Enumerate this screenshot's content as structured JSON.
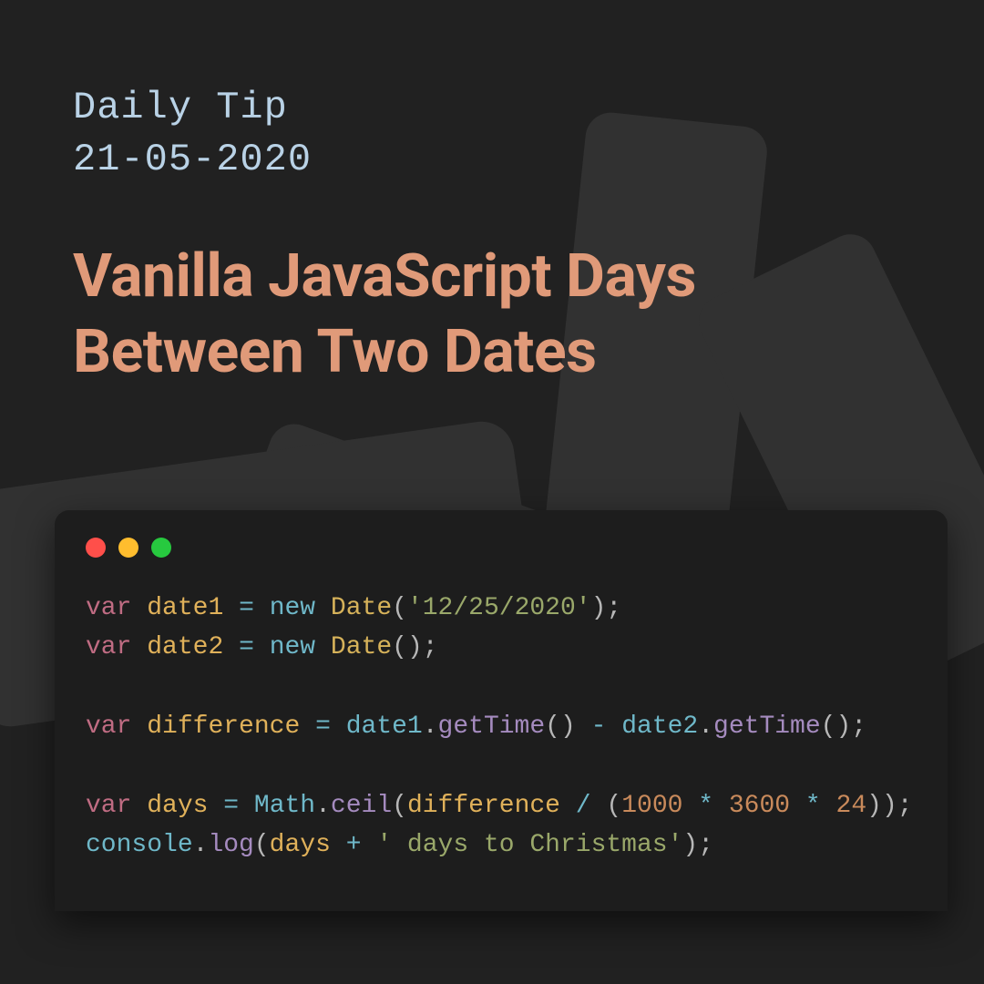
{
  "header": {
    "eyebrow_label": "Daily Tip",
    "date": "21-05-2020",
    "title": "Vanilla JavaScript Days Between Two Dates"
  },
  "code": {
    "tokens": [
      [
        [
          "kw",
          "var"
        ],
        [
          "punc",
          " "
        ],
        [
          "var",
          "date1"
        ],
        [
          "punc",
          " "
        ],
        [
          "op",
          "="
        ],
        [
          "punc",
          " "
        ],
        [
          "new",
          "new"
        ],
        [
          "punc",
          " "
        ],
        [
          "cls",
          "Date"
        ],
        [
          "punc",
          "("
        ],
        [
          "str",
          "'12/25/2020'"
        ],
        [
          "punc",
          ");"
        ]
      ],
      [
        [
          "kw",
          "var"
        ],
        [
          "punc",
          " "
        ],
        [
          "var",
          "date2"
        ],
        [
          "punc",
          " "
        ],
        [
          "op",
          "="
        ],
        [
          "punc",
          " "
        ],
        [
          "new",
          "new"
        ],
        [
          "punc",
          " "
        ],
        [
          "cls",
          "Date"
        ],
        [
          "punc",
          "();"
        ]
      ],
      [],
      [
        [
          "kw",
          "var"
        ],
        [
          "punc",
          " "
        ],
        [
          "var",
          "difference"
        ],
        [
          "punc",
          " "
        ],
        [
          "op",
          "="
        ],
        [
          "punc",
          " "
        ],
        [
          "obj",
          "date1"
        ],
        [
          "punc",
          "."
        ],
        [
          "meth",
          "getTime"
        ],
        [
          "punc",
          "() "
        ],
        [
          "op",
          "-"
        ],
        [
          "punc",
          " "
        ],
        [
          "obj",
          "date2"
        ],
        [
          "punc",
          "."
        ],
        [
          "meth",
          "getTime"
        ],
        [
          "punc",
          "();"
        ]
      ],
      [],
      [
        [
          "kw",
          "var"
        ],
        [
          "punc",
          " "
        ],
        [
          "var",
          "days"
        ],
        [
          "punc",
          " "
        ],
        [
          "op",
          "="
        ],
        [
          "punc",
          " "
        ],
        [
          "obj",
          "Math"
        ],
        [
          "punc",
          "."
        ],
        [
          "meth",
          "ceil"
        ],
        [
          "punc",
          "("
        ],
        [
          "var",
          "difference"
        ],
        [
          "punc",
          " "
        ],
        [
          "op",
          "/"
        ],
        [
          "punc",
          " ("
        ],
        [
          "num",
          "1000"
        ],
        [
          "punc",
          " "
        ],
        [
          "op",
          "*"
        ],
        [
          "punc",
          " "
        ],
        [
          "num",
          "3600"
        ],
        [
          "punc",
          " "
        ],
        [
          "op",
          "*"
        ],
        [
          "punc",
          " "
        ],
        [
          "num",
          "24"
        ],
        [
          "punc",
          "));"
        ]
      ],
      [
        [
          "obj",
          "console"
        ],
        [
          "punc",
          "."
        ],
        [
          "meth",
          "log"
        ],
        [
          "punc",
          "("
        ],
        [
          "var",
          "days"
        ],
        [
          "punc",
          " "
        ],
        [
          "op",
          "+"
        ],
        [
          "punc",
          " "
        ],
        [
          "str",
          "' days to Christmas'"
        ],
        [
          "punc",
          ");"
        ]
      ]
    ]
  }
}
